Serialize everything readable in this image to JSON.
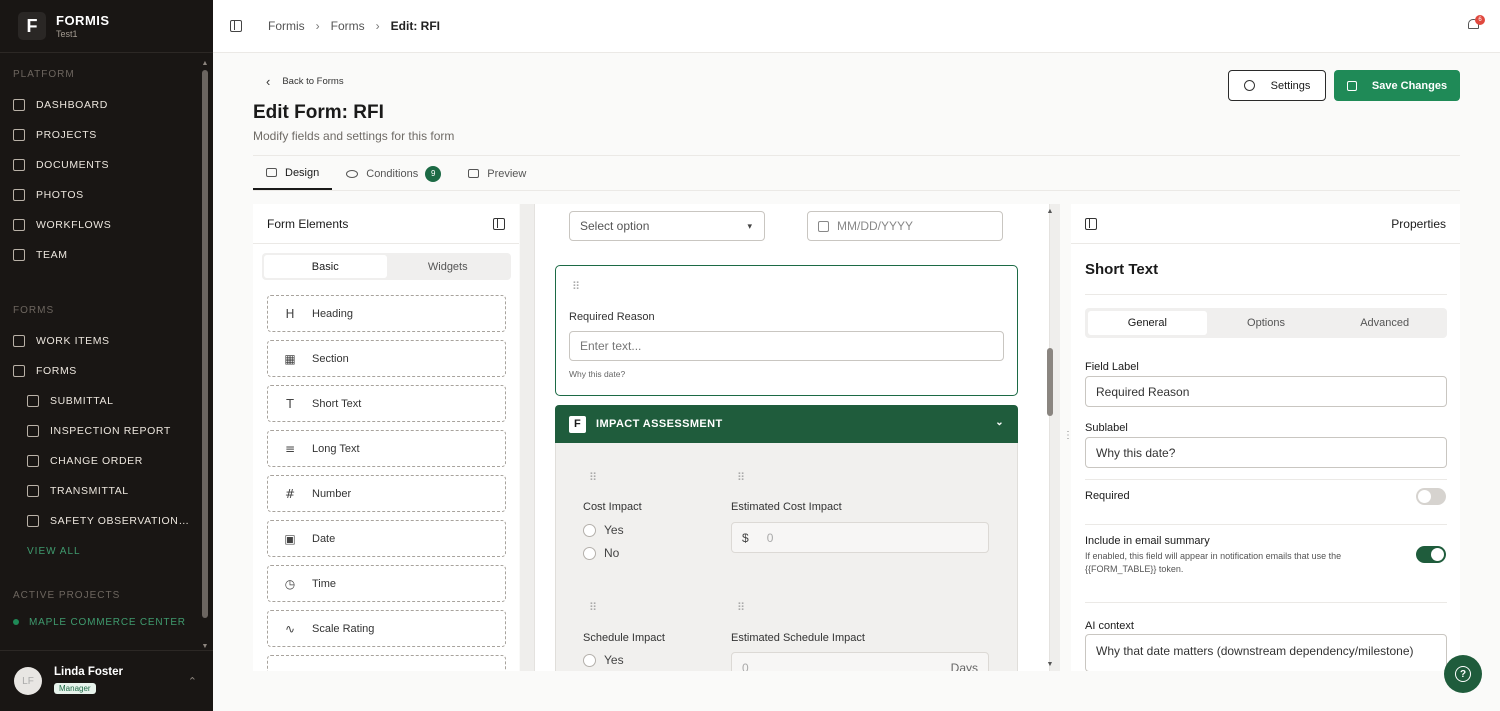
{
  "brand": {
    "logo": "F",
    "name": "FORMIS",
    "workspace": "Test1"
  },
  "sidebar": {
    "platform_title": "PLATFORM",
    "platform_items": [
      {
        "label": "DASHBOARD",
        "icon": "grid-icon"
      },
      {
        "label": "PROJECTS",
        "icon": "building-icon"
      },
      {
        "label": "DOCUMENTS",
        "icon": "document-icon"
      },
      {
        "label": "PHOTOS",
        "icon": "camera-icon"
      },
      {
        "label": "WORKFLOWS",
        "icon": "workflow-icon"
      },
      {
        "label": "TEAM",
        "icon": "users-icon"
      }
    ],
    "forms_title": "FORMS",
    "forms_items": [
      {
        "label": "WORK ITEMS",
        "icon": "list-icon"
      },
      {
        "label": "FORMS",
        "icon": "file-icon"
      }
    ],
    "form_sub_items": [
      {
        "label": "SUBMITTAL",
        "icon": "file-icon"
      },
      {
        "label": "INSPECTION REPORT",
        "icon": "file-icon"
      },
      {
        "label": "CHANGE ORDER",
        "icon": "file-icon"
      },
      {
        "label": "TRANSMITTAL",
        "icon": "share-icon"
      },
      {
        "label": "SAFETY OBSERVATION / IN...",
        "icon": "file-icon"
      }
    ],
    "view_all": "VIEW ALL",
    "active_projects_title": "ACTIVE PROJECTS",
    "active_project": "MAPLE COMMERCE CENTER"
  },
  "user": {
    "initials": "LF",
    "name": "Linda Foster",
    "role": "Manager"
  },
  "topbar": {
    "breadcrumbs": [
      "Formis",
      "Forms"
    ],
    "current": "Edit: RFI",
    "notifications": "6"
  },
  "header": {
    "back": "Back to Forms",
    "title": "Edit Form: RFI",
    "subtitle": "Modify fields and settings for this form",
    "settings_label": "Settings",
    "save_label": "Save Changes"
  },
  "tabs": [
    {
      "label": "Design"
    },
    {
      "label": "Conditions",
      "badge": "9"
    },
    {
      "label": "Preview"
    }
  ],
  "elements_panel": {
    "title": "Form Elements",
    "seg_basic": "Basic",
    "seg_widgets": "Widgets",
    "items": [
      {
        "label": "Heading",
        "glyph": "H"
      },
      {
        "label": "Section",
        "glyph": "▦"
      },
      {
        "label": "Short Text",
        "glyph": "T"
      },
      {
        "label": "Long Text",
        "glyph": "≡"
      },
      {
        "label": "Number",
        "glyph": "#"
      },
      {
        "label": "Date",
        "glyph": "▣"
      },
      {
        "label": "Time",
        "glyph": "◷"
      },
      {
        "label": "Scale Rating",
        "glyph": "∿"
      }
    ]
  },
  "canvas": {
    "select_placeholder": "Select option",
    "date_placeholder": "MM/DD/YYYY",
    "selected_field": {
      "label": "Required Reason",
      "placeholder": "Enter text...",
      "sublabel": "Why this date?"
    },
    "section": {
      "logo": "F",
      "title": "IMPACT ASSESSMENT",
      "cost_impact_label": "Cost Impact",
      "yes": "Yes",
      "no": "No",
      "est_cost_label": "Estimated Cost Impact",
      "currency": "$",
      "cost_placeholder": "0",
      "schedule_impact_label": "Schedule Impact",
      "est_schedule_label": "Estimated Schedule Impact",
      "schedule_placeholder": "0",
      "schedule_unit": "Days"
    }
  },
  "properties": {
    "panel_title": "Properties",
    "field_type": "Short Text",
    "tabs": [
      "General",
      "Options",
      "Advanced"
    ],
    "field_label_title": "Field Label",
    "field_label_value": "Required Reason",
    "sublabel_title": "Sublabel",
    "sublabel_value": "Why this date?",
    "required_title": "Required",
    "required_on": false,
    "email_title": "Include in email summary",
    "email_desc": "If enabled, this field will appear in notification emails that use the {{FORM_TABLE}} token.",
    "email_on": true,
    "ai_title": "AI context",
    "ai_value": "Why that date matters (downstream dependency/milestone)"
  },
  "colors": {
    "accent": "#1f8a57",
    "dark_green": "#1f5c3c",
    "sidebar": "#191614"
  }
}
